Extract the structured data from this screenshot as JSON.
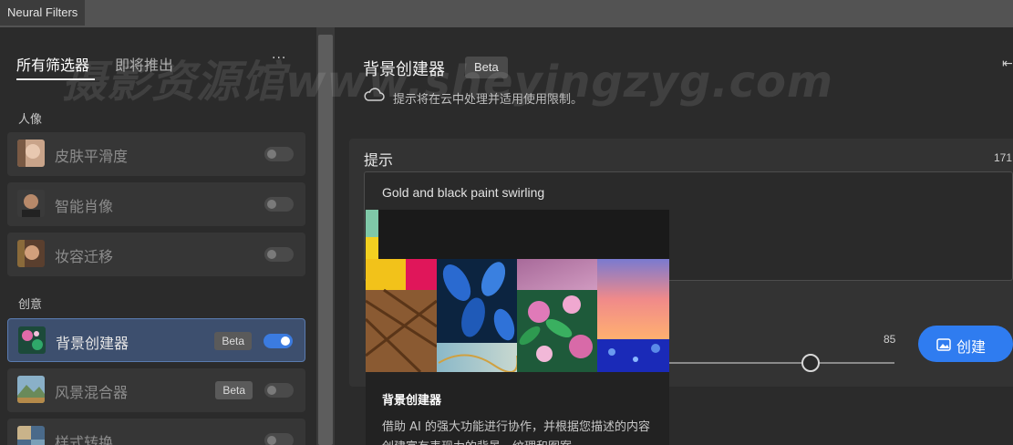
{
  "window": {
    "title": "Neural Filters"
  },
  "left_panel": {
    "tabs": [
      {
        "label": "所有筛选器",
        "active": true
      },
      {
        "label": "即将推出",
        "active": false
      }
    ],
    "more_label": "···",
    "sections": [
      {
        "label": "人像",
        "items": [
          {
            "label": "皮肤平滑度",
            "enabled": false,
            "icon": "portrait-thumbnail-icon"
          },
          {
            "label": "智能肖像",
            "enabled": false,
            "icon": "portrait-thumbnail-icon"
          },
          {
            "label": "妆容迁移",
            "enabled": false,
            "icon": "portrait-thumbnail-icon"
          }
        ]
      },
      {
        "label": "创意",
        "items": [
          {
            "label": "背景创建器",
            "badge": "Beta",
            "enabled": true,
            "selected": true,
            "icon": "floral-thumbnail-icon"
          },
          {
            "label": "风景混合器",
            "badge": "Beta",
            "enabled": false,
            "icon": "landscape-thumbnail-icon"
          },
          {
            "label": "样式转换",
            "enabled": false,
            "icon": "style-thumbnail-icon"
          }
        ]
      }
    ]
  },
  "right_panel": {
    "title": "背景创建器",
    "badge": "Beta",
    "cloud_note": "提示将在云中处理并适用使用限制。",
    "prompt": {
      "label": "提示",
      "char_count": "171",
      "text": "Gold and black paint swirling"
    },
    "slider_value": "85",
    "create_label": "创建"
  },
  "popup": {
    "title": "背景创建器",
    "description": "借助 AI 的强大功能进行协作，并根据您描述的内容创建富有表现力的背景、纹理和图案"
  },
  "watermark": "摄影资源馆www.sheyingzyg.com",
  "colors": {
    "accent": "#2f7cf0",
    "selected_item": "#3d4f6e",
    "panel_bg": "#2b2b2b"
  }
}
